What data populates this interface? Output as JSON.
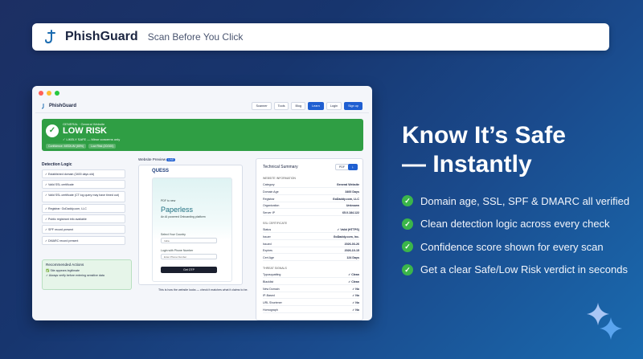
{
  "brand": {
    "name": "PhishGuard",
    "tagline": "Scan Before You Click"
  },
  "app": {
    "name": "PhishGuard",
    "nav": [
      "Scanner",
      "Tools",
      "Blog",
      "Learn",
      "Login",
      "Sign up"
    ]
  },
  "risk": {
    "category": "GENERAL · General Website",
    "verdict": "LOW RISK",
    "subtitle": "✓ LIKELY SAFE — Minor concerns only",
    "pills": [
      "Confidence: MEDIUM (65%)",
      "Low Risk (20/100)"
    ]
  },
  "detection": {
    "title": "Detection Logic",
    "items": [
      "✓ Established domain (3400 days old)",
      "✓ Valid SSL certificate",
      "✓ Valid SSL certificate (CT log query may have timed out)",
      "✓ Registrar: GoDaddy.com, LLC",
      "✓ Public registrant info available",
      "✓ SPF record present",
      "✓ DMARC record present"
    ]
  },
  "recommended": {
    "title": "Recommended Actions",
    "items": [
      "✅ Site appears legitimate",
      "✓ Always verify before entering sensitive data"
    ]
  },
  "preview": {
    "title": "Website Preview",
    "badge": "LIVE",
    "site_logo": "QUESS",
    "eyebrow": "PDF to new",
    "site_title": "Paperless",
    "site_sub": "An AI powered Onboarding platform",
    "country_label": "Select Your Country",
    "country_value": "India",
    "phone_label": "Login with Phone Number",
    "phone_placeholder": "Enter Phone Number",
    "button": "Get OTP",
    "caption": "This is how the website looks — check it matches what it claims to be."
  },
  "tech": {
    "title": "Technical Summary",
    "buttons": [
      "PDF",
      "⤓"
    ],
    "sections": [
      {
        "title": "WEBSITE INFORMATION",
        "rows": [
          [
            "Category",
            "General Website"
          ],
          [
            "Domain Age",
            "3400 Days"
          ],
          [
            "Registrar",
            "GoDaddy.com, LLC"
          ],
          [
            "Organization",
            "Unknown"
          ],
          [
            "Server IP",
            "65.0.184.122"
          ]
        ]
      },
      {
        "title": "SSL CERTIFICATE",
        "rows": [
          [
            "Status",
            "✓ Valid (HTTPS)"
          ],
          [
            "Issuer",
            "GoDaddy.com, Inc."
          ],
          [
            "Issued",
            "2026-03-26"
          ],
          [
            "Expires",
            "2026-10-15"
          ],
          [
            "Cert Age",
            "124 Days"
          ]
        ]
      },
      {
        "title": "THREAT SIGNALS",
        "rows": [
          [
            "Typosquatting",
            "✓ Clean"
          ],
          [
            "Blacklist",
            "✓ Clean"
          ],
          [
            "New Domain",
            "✓ No"
          ],
          [
            "IP-Based",
            "✓ No"
          ],
          [
            "URL Shortener",
            "✓ No"
          ],
          [
            "Homograph",
            "✓ No"
          ]
        ]
      }
    ]
  },
  "marketing": {
    "headline_1": "Know It’s Safe",
    "headline_2": "— Instantly",
    "bullets": [
      "Domain age, SSL, SPF & DMARC all verified",
      "Clean detection logic across every check",
      "Confidence score shown for every scan",
      "Get a clear Safe/Low Risk verdict in seconds"
    ]
  },
  "colors": {
    "accent_green": "#2f9e44",
    "brand_blue": "#1f5fd1",
    "bg_dark": "#1c2f63"
  }
}
